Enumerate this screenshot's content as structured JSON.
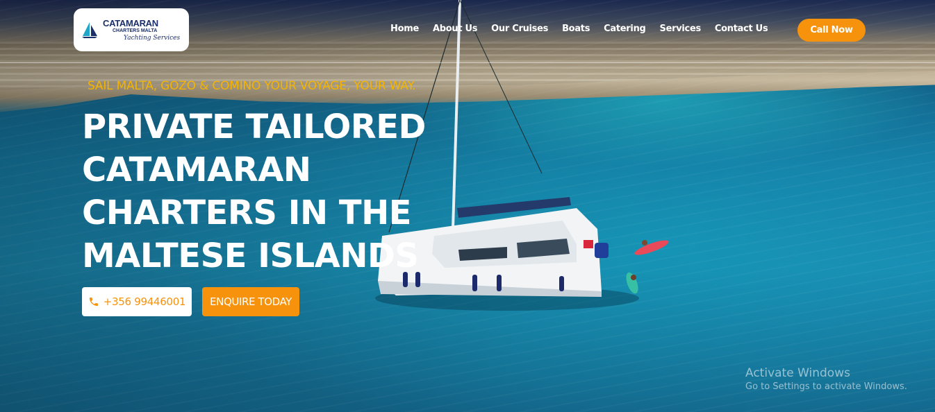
{
  "logo": {
    "title": "CATAMARAN",
    "subtitle": "CHARTERS MALTA",
    "script": "Yachting Services",
    "icon": "sailboat-icon"
  },
  "nav": {
    "items": [
      {
        "label": "Home"
      },
      {
        "label": "About Us"
      },
      {
        "label": "Our Cruises"
      },
      {
        "label": "Boats"
      },
      {
        "label": "Catering"
      },
      {
        "label": "Services"
      },
      {
        "label": "Contact Us"
      }
    ],
    "call_label": "Call Now"
  },
  "hero": {
    "tagline": "SAIL MALTA, GOZO & COMINO YOUR VOYAGE, YOUR WAY.",
    "headline_lines": [
      "PRIVATE TAILORED",
      "CATAMARAN",
      "CHARTERS IN THE",
      "MALTESE ISLANDS"
    ],
    "phone_label": "+356 99446001",
    "phone_icon": "phone-icon",
    "enquire_label": "ENQUIRE TODAY"
  },
  "watermark": {
    "title": "Activate Windows",
    "subtitle": "Go to Settings to activate Windows."
  },
  "colors": {
    "accent": "#f7920c",
    "tagline": "#f4b400",
    "logo_navy": "#1b2f6b"
  }
}
